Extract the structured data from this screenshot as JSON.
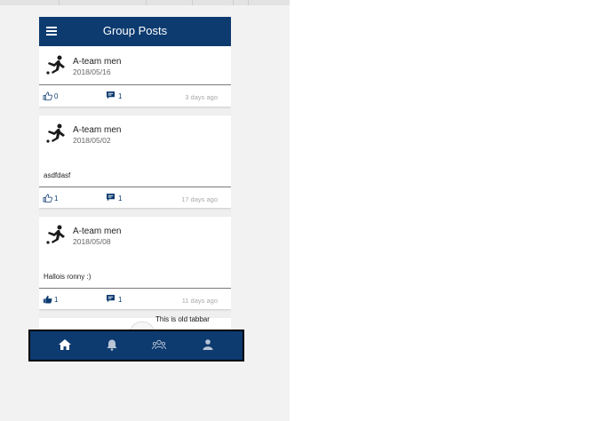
{
  "app": {
    "title": "Group Posts"
  },
  "posts": [
    {
      "group": "A-team men",
      "date": "2018/05/16",
      "body": "",
      "likes": "0",
      "comments": "1",
      "ago": "3 days ago",
      "liked": false
    },
    {
      "group": "A-team men",
      "date": "2018/05/02",
      "body": "asdfdasf",
      "likes": "1",
      "comments": "1",
      "ago": "17 days ago",
      "liked": false
    },
    {
      "group": "A-team men",
      "date": "2018/05/08",
      "body": "Hallois ronny :)",
      "likes": "1",
      "comments": "1",
      "ago": "11 days ago",
      "liked": true
    }
  ],
  "tabbar": {
    "label": "This is old tabbar",
    "tabs": [
      {
        "icon": "home-icon",
        "active": true
      },
      {
        "icon": "bell-icon",
        "active": false
      },
      {
        "icon": "group-icon",
        "active": false
      },
      {
        "icon": "profile-icon",
        "active": false
      }
    ]
  },
  "colors": {
    "primary": "#0d3b70",
    "background": "#efefef",
    "muted": "#aaaaaa"
  }
}
